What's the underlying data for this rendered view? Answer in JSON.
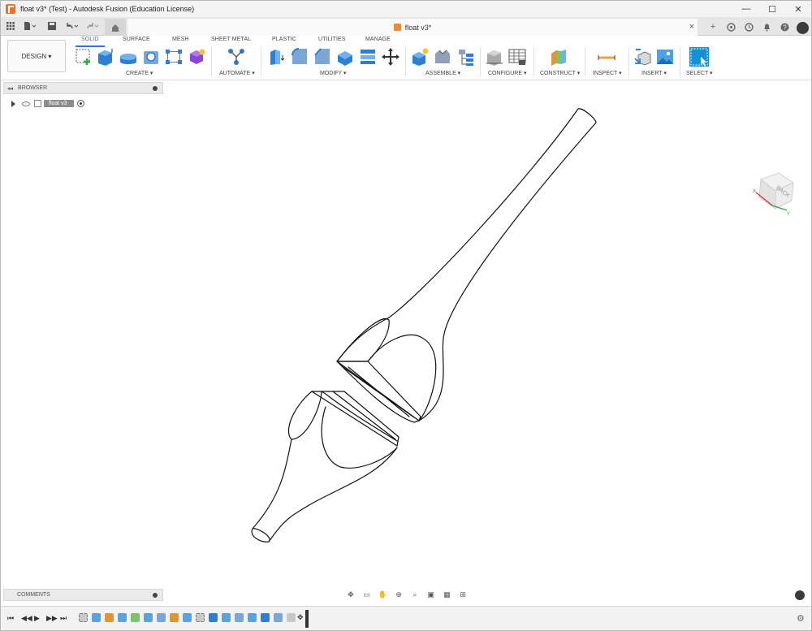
{
  "window": {
    "title": "float v3* (Test) - Autodesk Fusion (Education License)",
    "minimize": "—",
    "maximize": "☐",
    "close": "✕"
  },
  "quickaccess": {
    "grid_icon": "grid-icon",
    "file_icon": "file-icon",
    "save_icon": "save-icon",
    "undo_icon": "undo-icon",
    "redo_icon": "redo-icon",
    "home_icon": "home-icon"
  },
  "doc_tab": {
    "label": "float v3*",
    "close": "×"
  },
  "ribbon": {
    "workspace": "DESIGN ▾",
    "tabs": [
      "SOLID",
      "SURFACE",
      "MESH",
      "SHEET METAL",
      "PLASTIC",
      "UTILITIES",
      "MANAGE"
    ],
    "groups": [
      "CREATE ▾",
      "AUTOMATE ▾",
      "MODIFY ▾",
      "ASSEMBLE ▾",
      "CONFIGURE ▾",
      "CONSTRUCT ▾",
      "INSPECT ▾",
      "INSERT ▾",
      "SELECT ▾"
    ]
  },
  "browser": {
    "title": "BROWSER",
    "root_label": "float v3"
  },
  "viewcube": {
    "face": "BACK"
  },
  "comments": {
    "title": "COMMENTS"
  },
  "colors": {
    "accent": "#2a78d6",
    "brand_orange": "#e8742a",
    "select_blue": "#1591d6"
  }
}
